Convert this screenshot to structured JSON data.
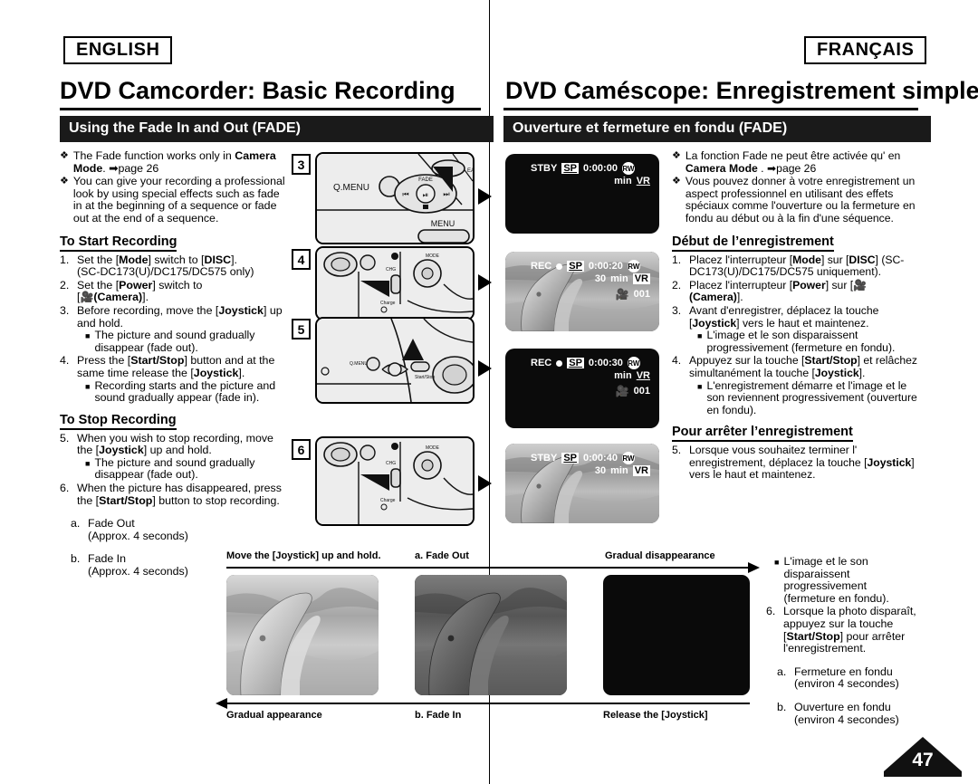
{
  "language_chips": {
    "left": "ENGLISH",
    "right": "FRANÇAIS"
  },
  "titles": {
    "en": "DVD Camcorder: Basic Recording",
    "fr": "DVD Caméscope: Enregistrement simple"
  },
  "section_bars": {
    "en": "Using the Fade In and Out (FADE)",
    "fr": "Ouverture et fermeture en fondu (FADE)"
  },
  "english": {
    "bullets": [
      {
        "mark": "❖",
        "html": "The Fade function works only in <b>Camera Mode</b>. ➡page 26"
      },
      {
        "mark": "❖",
        "html": "You can give your recording a professional look by using special effects such as fade in at the beginning of a sequence or fade out at the end of a sequence."
      }
    ],
    "start_heading": "To Start Recording",
    "start_steps": [
      {
        "num": "1.",
        "html": "Set the [<b>Mode</b>] switch to [<b>DISC</b>].<br>(SC-DC173(U)/DC175/DC575 only)"
      },
      {
        "num": "2.",
        "html": "Set the [<b>Power</b>] switch to<br>[<span class=\"camglyph\">🎥</span><b>(Camera)</b>]."
      },
      {
        "num": "3.",
        "html": "Before recording, move the [<b>Joystick</b>] up and hold.",
        "sub": [
          "The picture and sound gradually disappear (fade out)."
        ]
      },
      {
        "num": "4.",
        "html": "Press the [<b>Start/Stop</b>] button and at the same time release the [<b>Joystick</b>].",
        "sub": [
          "Recording starts and the picture and sound gradually appear (fade in)."
        ]
      }
    ],
    "stop_heading": "To Stop Recording",
    "stop_steps": [
      {
        "num": "5.",
        "html": "When you wish to stop recording, move the [<b>Joystick</b>] up and hold.",
        "sub": [
          "The picture and sound gradually disappear (fade out)."
        ]
      },
      {
        "num": "6.",
        "html": "When the picture has disappeared, press the [<b>Start/Stop</b>] button to stop recording.",
        "sub": []
      }
    ],
    "fade_notes": [
      {
        "letter": "a.",
        "html": "Fade Out<br>(Approx. 4 seconds)"
      },
      {
        "letter": "b.",
        "html": "Fade In<br>(Approx. 4 seconds)"
      }
    ]
  },
  "french": {
    "bullets": [
      {
        "mark": "❖",
        "html": "La fonction Fade ne peut être activée qu' en <b>Camera Mode</b> . ➡page 26"
      },
      {
        "mark": "❖",
        "html": "Vous pouvez donner à votre enregistrement un aspect professionnel en utilisant des effets spéciaux comme l'ouverture ou la fermeture en fondu au début ou à la fin d'une séquence."
      }
    ],
    "start_heading": "Début de l’enregistrement",
    "start_steps": [
      {
        "num": "1.",
        "html": "Placez l'interrupteur [<b>Mode</b>] sur [<b>DISC</b>] (SC-DC173(U)/DC175/DC575 uniquement)."
      },
      {
        "num": "2.",
        "html": "Placez l'interrupteur [<b>Power</b>] sur [<span class=\"camglyph\">🎥</span><b>(Camera)</b>]."
      },
      {
        "num": "3.",
        "html": "Avant d'enregistrer, déplacez la touche [<b>Joystick</b>] vers le haut et maintenez.",
        "sub": [
          "L'image et le son disparaissent progressivement (fermeture en fondu)."
        ]
      },
      {
        "num": "4.",
        "html": "Appuyez sur la touche [<b>Start/Stop</b>] et relâchez simultanément la touche [<b>Joystick</b>].",
        "sub": [
          "L'enregistrement démarre et l'image et le son reviennent progressivement (ouverture en fondu)."
        ]
      }
    ],
    "stop_heading": "Pour arrêter l’enregistrement",
    "stop_steps": [
      {
        "num": "5.",
        "html": "Lorsque vous souhaitez terminer l' enregistrement, déplacez la touche [<b>Joystick</b>] vers le haut et maintenez.",
        "sub": []
      },
      {
        "num": "6.",
        "html": "Lorsque la photo disparaît, appuyez sur la touche [<b>Start/Stop</b>] pour arrêter l'enregistrement.",
        "sub": []
      }
    ],
    "narrow_sub": [
      "L'image et le son disparaissent progressivement (fermeture en fondu)."
    ],
    "fade_notes": [
      {
        "letter": "a.",
        "html": "Fermeture en fondu<br>(environ 4 secondes)"
      },
      {
        "letter": "b.",
        "html": "Ouverture en fondu<br>(environ 4 secondes)"
      }
    ]
  },
  "steps_illustrations": [
    {
      "num": "3",
      "labels": [
        "Q.MENU",
        "FADE",
        "MENU",
        "EASY.Q"
      ]
    },
    {
      "num": "4",
      "labels": [
        "Mode",
        "CHG",
        "Charge"
      ]
    },
    {
      "num": "5",
      "labels": [
        "Q.MENU",
        "Start/Stop"
      ]
    },
    {
      "num": "6",
      "labels": [
        "Mode",
        "CHG",
        "Charge"
      ]
    }
  ],
  "lcd_screens": [
    {
      "id": "lcd-1",
      "status": "STBY",
      "rec_dot": false,
      "quality": "SP",
      "timecode": "0:00:00",
      "disc": "RW",
      "remaining": "",
      "min_label": "min",
      "format": "VR",
      "counter": "",
      "image": "black"
    },
    {
      "id": "lcd-2",
      "status": "REC",
      "rec_dot": true,
      "quality": "SP",
      "timecode": "0:00:20",
      "disc": "RW",
      "remaining": "30",
      "min_label": "min",
      "format": "VR",
      "counter": "001",
      "image": "dolphin-bright"
    },
    {
      "id": "lcd-3",
      "status": "REC",
      "rec_dot": true,
      "quality": "SP",
      "timecode": "0:00:30",
      "disc": "RW",
      "remaining": "",
      "min_label": "min",
      "format": "VR",
      "counter": "001",
      "image": "black"
    },
    {
      "id": "lcd-4",
      "status": "STBY",
      "rec_dot": false,
      "quality": "SP",
      "timecode": "0:00:40",
      "disc": "RW",
      "remaining": "30",
      "min_label": "min",
      "format": "VR",
      "counter": "",
      "image": "dolphin-bright"
    }
  ],
  "filmstrip": {
    "top_captions": [
      "Move the [Joystick] up and hold.",
      "a. Fade Out",
      "Gradual disappearance"
    ],
    "bottom_captions": [
      "Gradual appearance",
      "b. Fade In",
      "Release the [Joystick]"
    ],
    "frames": [
      "dolphin-bright",
      "dolphin-dim",
      "black"
    ]
  },
  "page_number": "47",
  "colors": {
    "bar": "#1a1a1a",
    "ink": "#000000",
    "paper": "#ffffff",
    "illus_fill": "#ededed"
  }
}
